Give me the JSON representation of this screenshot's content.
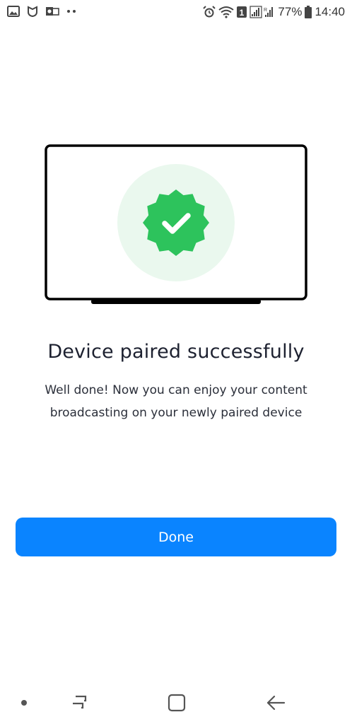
{
  "status_bar": {
    "battery": "77%",
    "time": "14:40",
    "sim": "1",
    "left_icons": [
      "gallery-icon",
      "shield-icon",
      "outlook-icon",
      "more-dots-icon"
    ],
    "right_icons": [
      "alarm-icon",
      "wifi-icon",
      "sim-icon",
      "signal-icon",
      "battery-icon"
    ]
  },
  "illustration": {
    "icon": "verified-badge-check-icon",
    "badge_color": "#2dc35c",
    "halo_color": "#eaf8ee",
    "frame_color": "#000000"
  },
  "content": {
    "title": "Device paired successfully",
    "message_line1": "Well done! Now you can enjoy your content",
    "message_line2": "broadcasting on your newly paired device"
  },
  "actions": {
    "done_label": "Done",
    "accent": "#0a84ff"
  },
  "nav_bar": {
    "icons": [
      "dot-icon",
      "recent-apps-icon",
      "home-icon",
      "back-icon"
    ]
  }
}
